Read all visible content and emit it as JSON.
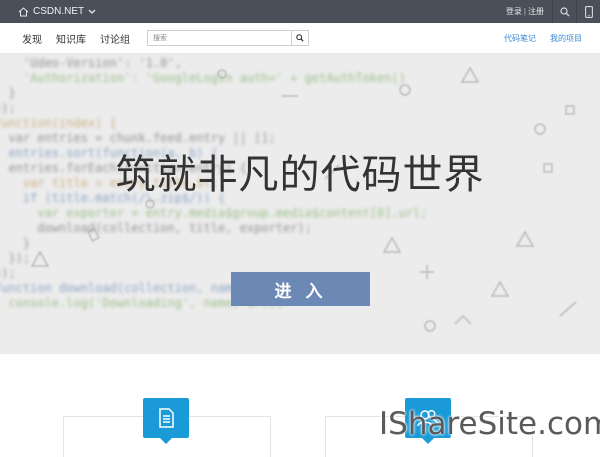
{
  "topbar": {
    "brand": "CSDN.NET",
    "login": "登录",
    "separator": "|",
    "register": "注册"
  },
  "nav": {
    "links": [
      "发现",
      "知识库",
      "讨论组"
    ],
    "search_placeholder": "搜索",
    "right_links": [
      "代码笔记",
      "我的项目"
    ]
  },
  "hero": {
    "title": "筑就非凡的代码世界",
    "enter_label": "进 入",
    "background_code": [
      "    'Udeo-Version': '1.0',",
      "    'Authorization': 'GoogleLogin auth=' + getAuthToken()",
      "  }",
      "});",
      "function(index) {",
      "  var entries = chunk.feed.entry || [];",
      "  entries.sort(function(a, b) {",
      "  entries.forEach(function(entry) {",
      "    var title = entry.title.$t;",
      "    if (title.match(/\\.zip$/)) {",
      "      var exporter = entry.media$group.media$content[0].url;",
      "      download(collection, title, exporter);",
      "    }",
      "  });",
      "});",
      "",
      "",
      "",
      "function download(collection, name, url) {",
      "  console.log('Downloading', name, url);"
    ]
  },
  "watermark": "IShareSite.com",
  "colors": {
    "topbar_bg": "#4a5059",
    "link_blue": "#3d8ad6",
    "enter_button": "#6c88b5",
    "card_icon": "#1a9ad6"
  }
}
